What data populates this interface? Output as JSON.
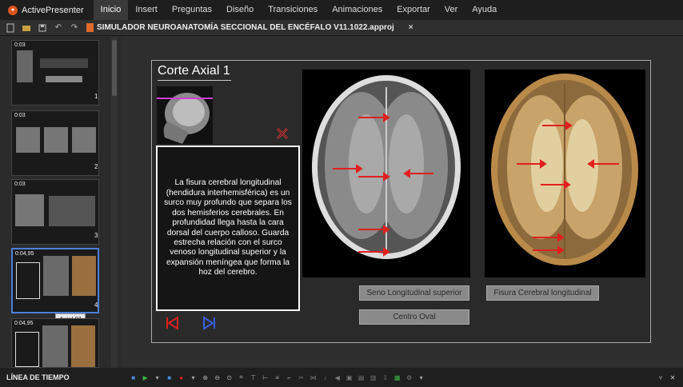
{
  "app": {
    "name": "ActivePresenter"
  },
  "menu": [
    "Inicio",
    "Insert",
    "Preguntas",
    "Diseño",
    "Transiciones",
    "Animaciones",
    "Exportar",
    "Ver",
    "Ayuda"
  ],
  "document": {
    "tab_title": "SIMULADOR NEUROANATOMÍA SECCIONAL DEL ENCÉFALO V11.1022.approj",
    "close": "×"
  },
  "slides": [
    {
      "time": "0:03",
      "number": "1"
    },
    {
      "time": "0:03",
      "number": "2"
    },
    {
      "time": "0:03",
      "number": "3"
    },
    {
      "time": "0:04,95",
      "number": "4",
      "tooltip": "Axial 01"
    },
    {
      "time": "0:04,95",
      "number": ""
    }
  ],
  "slide": {
    "title": "Corte Axial 1",
    "info_text": "La fisura cerebral longitudinal (hendidura interhemisférica) es un surco muy profundo que separa los dos hemisferios cerebrales. En profundidad llega hasta la cara dorsal del cuerpo calloso. Guarda estrecha relación con el surco venoso longitudinal superior y la expansión meníngea que forma la hoz del cerebro.",
    "buttons": {
      "seno": "Seno Longitudinal superior",
      "fisura": "Fisura Cerebral longitudinal",
      "centro": "Centro Oval"
    }
  },
  "statusbar": {
    "label": "LÍNEA DE TIEMPO"
  },
  "colors": {
    "accent_red": "#e02020",
    "nav_blue": "#3a5fe0",
    "selection": "#4d7fd8"
  }
}
